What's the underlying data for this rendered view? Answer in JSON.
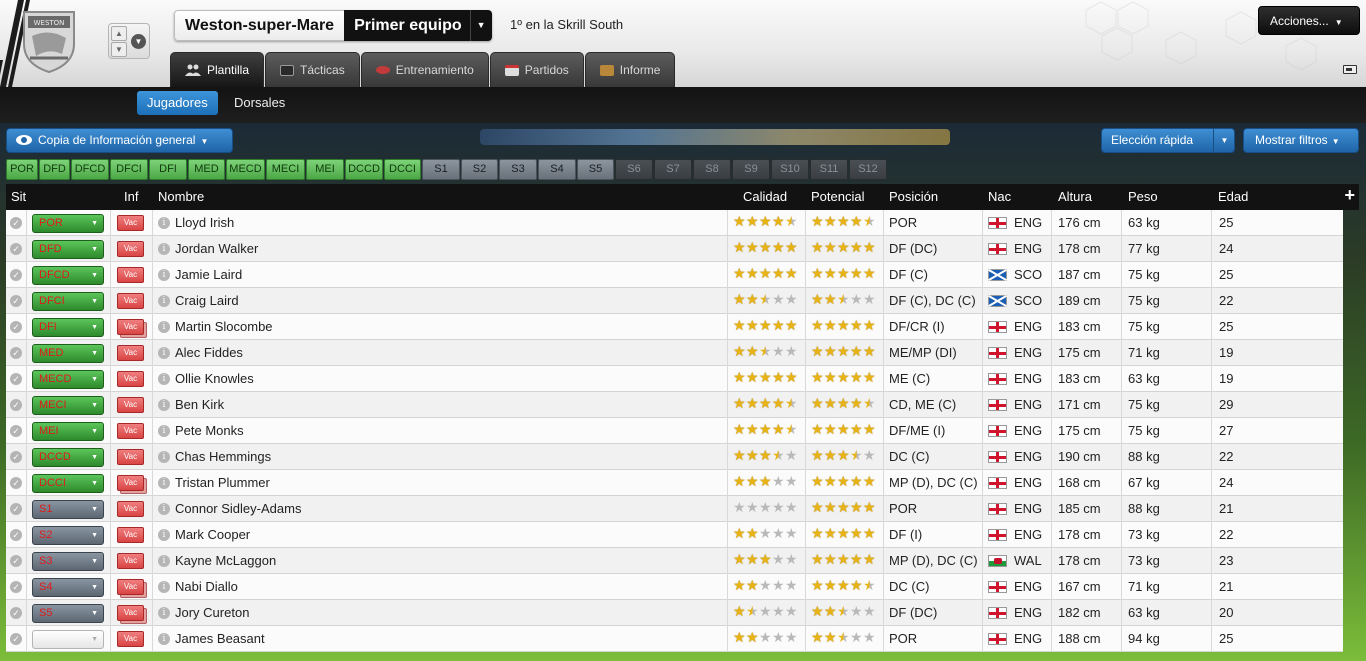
{
  "header": {
    "club_name": "Weston-super-Mare",
    "team_name": "Primer equipo",
    "league_position": "1º en la Skrill South",
    "actions_label": "Acciones...",
    "crest_text": "WESTON"
  },
  "tabs": [
    {
      "label": "Plantilla",
      "icon": "squad-icon",
      "active": true
    },
    {
      "label": "Tácticas",
      "icon": "tactics-board-icon",
      "active": false
    },
    {
      "label": "Entrenamiento",
      "icon": "training-icon",
      "active": false
    },
    {
      "label": "Partidos",
      "icon": "fixtures-icon",
      "active": false
    },
    {
      "label": "Informe",
      "icon": "report-icon",
      "active": false
    }
  ],
  "subnav": {
    "players_label": "Jugadores",
    "numbers_label": "Dorsales"
  },
  "toolbar": {
    "view_label": "Copia de Información general",
    "quick_pick_label": "Elección rápida",
    "filters_label": "Mostrar filtros"
  },
  "position_chips": [
    {
      "label": "POR",
      "kind": "g"
    },
    {
      "label": "DFD",
      "kind": "g"
    },
    {
      "label": "DFCD",
      "kind": "g"
    },
    {
      "label": "DFCI",
      "kind": "g"
    },
    {
      "label": "DFI",
      "kind": "g"
    },
    {
      "label": "MED",
      "kind": "g"
    },
    {
      "label": "MECD",
      "kind": "g"
    },
    {
      "label": "MECI",
      "kind": "g"
    },
    {
      "label": "MEI",
      "kind": "g"
    },
    {
      "label": "DCCD",
      "kind": "g"
    },
    {
      "label": "DCCI",
      "kind": "g"
    },
    {
      "label": "S1",
      "kind": "s"
    },
    {
      "label": "S2",
      "kind": "s"
    },
    {
      "label": "S3",
      "kind": "s"
    },
    {
      "label": "S4",
      "kind": "s"
    },
    {
      "label": "S5",
      "kind": "s"
    },
    {
      "label": "S6",
      "kind": "d"
    },
    {
      "label": "S7",
      "kind": "d"
    },
    {
      "label": "S8",
      "kind": "d"
    },
    {
      "label": "S9",
      "kind": "d"
    },
    {
      "label": "S10",
      "kind": "d"
    },
    {
      "label": "S11",
      "kind": "d"
    },
    {
      "label": "S12",
      "kind": "d"
    }
  ],
  "columns": {
    "sit": "Sit",
    "inf": "Inf",
    "name": "Nombre",
    "ability": "Calidad",
    "potential": "Potencial",
    "position": "Posición",
    "nationality": "Nac",
    "height": "Altura",
    "weight": "Peso",
    "age": "Edad"
  },
  "colors": {
    "status_green": "#2d8a2b",
    "status_slate": "#5c6772",
    "status_red_text": "#e01a1a",
    "star_gold": "#e8b314",
    "accent_blue": "#1f65a8"
  },
  "players": [
    {
      "sit": "POR",
      "sit_kind": "g",
      "inf": "Vac",
      "inf_stack": false,
      "name": "Lloyd Irish",
      "ability": 4.5,
      "potential": 4.5,
      "position": "POR",
      "nat": "ENG",
      "height": "176 cm",
      "weight": "63 kg",
      "age": "25"
    },
    {
      "sit": "DFD",
      "sit_kind": "g",
      "inf": "Vac",
      "inf_stack": false,
      "name": "Jordan Walker",
      "ability": 5,
      "potential": 5,
      "position": "DF (DC)",
      "nat": "ENG",
      "height": "178 cm",
      "weight": "77 kg",
      "age": "24"
    },
    {
      "sit": "DFCD",
      "sit_kind": "g",
      "inf": "Vac",
      "inf_stack": false,
      "name": "Jamie Laird",
      "ability": 5,
      "potential": 5,
      "position": "DF (C)",
      "nat": "SCO",
      "height": "187 cm",
      "weight": "75 kg",
      "age": "25"
    },
    {
      "sit": "DFCI",
      "sit_kind": "g",
      "inf": "Vac",
      "inf_stack": false,
      "name": "Craig Laird",
      "ability": 2.5,
      "potential": 2.5,
      "position": "DF (C), DC (C)",
      "nat": "SCO",
      "height": "189 cm",
      "weight": "75 kg",
      "age": "22"
    },
    {
      "sit": "DFI",
      "sit_kind": "g",
      "inf": "Vac",
      "inf_stack": true,
      "name": "Martin Slocombe",
      "ability": 5,
      "potential": 5,
      "position": "DF/CR (I)",
      "nat": "ENG",
      "height": "183 cm",
      "weight": "75 kg",
      "age": "25"
    },
    {
      "sit": "MED",
      "sit_kind": "g",
      "inf": "Vac",
      "inf_stack": false,
      "name": "Alec Fiddes",
      "ability": 2.5,
      "potential": 5,
      "position": "ME/MP (DI)",
      "nat": "ENG",
      "height": "175 cm",
      "weight": "71 kg",
      "age": "19"
    },
    {
      "sit": "MECD",
      "sit_kind": "g",
      "inf": "Vac",
      "inf_stack": false,
      "name": "Ollie Knowles",
      "ability": 5,
      "potential": 5,
      "position": "ME (C)",
      "nat": "ENG",
      "height": "183 cm",
      "weight": "63 kg",
      "age": "19"
    },
    {
      "sit": "MECI",
      "sit_kind": "g",
      "inf": "Vac",
      "inf_stack": false,
      "name": "Ben Kirk",
      "ability": 4.5,
      "potential": 4.5,
      "position": "CD, ME (C)",
      "nat": "ENG",
      "height": "171 cm",
      "weight": "75 kg",
      "age": "29"
    },
    {
      "sit": "MEI",
      "sit_kind": "g",
      "inf": "Vac",
      "inf_stack": false,
      "name": "Pete Monks",
      "ability": 4.5,
      "potential": 5,
      "position": "DF/ME (I)",
      "nat": "ENG",
      "height": "175 cm",
      "weight": "75 kg",
      "age": "27"
    },
    {
      "sit": "DCCD",
      "sit_kind": "g",
      "inf": "Vac",
      "inf_stack": false,
      "name": "Chas Hemmings",
      "ability": 3.5,
      "potential": 3.5,
      "position": "DC (C)",
      "nat": "ENG",
      "height": "190 cm",
      "weight": "88 kg",
      "age": "22"
    },
    {
      "sit": "DCCI",
      "sit_kind": "g",
      "inf": "Vac",
      "inf_stack": true,
      "name": "Tristan Plummer",
      "ability": 3,
      "potential": 5,
      "position": "MP (D), DC (C)",
      "nat": "ENG",
      "height": "168 cm",
      "weight": "67 kg",
      "age": "24"
    },
    {
      "sit": "S1",
      "sit_kind": "s",
      "inf": "Vac",
      "inf_stack": false,
      "name": "Connor Sidley-Adams",
      "ability": 0,
      "potential": 5,
      "position": "POR",
      "nat": "ENG",
      "height": "185 cm",
      "weight": "88 kg",
      "age": "21"
    },
    {
      "sit": "S2",
      "sit_kind": "s",
      "inf": "Vac",
      "inf_stack": false,
      "name": "Mark Cooper",
      "ability": 2,
      "potential": 5,
      "position": "DF (I)",
      "nat": "ENG",
      "height": "178 cm",
      "weight": "73 kg",
      "age": "22"
    },
    {
      "sit": "S3",
      "sit_kind": "s",
      "inf": "Vac",
      "inf_stack": false,
      "name": "Kayne McLaggon",
      "ability": 3,
      "potential": 5,
      "position": "MP (D), DC (C)",
      "nat": "WAL",
      "height": "178 cm",
      "weight": "73 kg",
      "age": "23"
    },
    {
      "sit": "S4",
      "sit_kind": "s",
      "inf": "Vac",
      "inf_stack": true,
      "name": "Nabi Diallo",
      "ability": 2,
      "potential": 4.5,
      "position": "DC (C)",
      "nat": "ENG",
      "height": "167 cm",
      "weight": "71 kg",
      "age": "21"
    },
    {
      "sit": "S5",
      "sit_kind": "s",
      "inf": "Vac",
      "inf_stack": true,
      "name": "Jory Cureton",
      "ability": 1.5,
      "potential": 2.5,
      "position": "DF (DC)",
      "nat": "ENG",
      "height": "182 cm",
      "weight": "63 kg",
      "age": "20"
    },
    {
      "sit": "",
      "sit_kind": "e",
      "inf": "Vac",
      "inf_stack": false,
      "name": "James Beasant",
      "ability": 2,
      "potential": 2.5,
      "position": "POR",
      "nat": "ENG",
      "height": "188 cm",
      "weight": "94 kg",
      "age": "25"
    }
  ]
}
